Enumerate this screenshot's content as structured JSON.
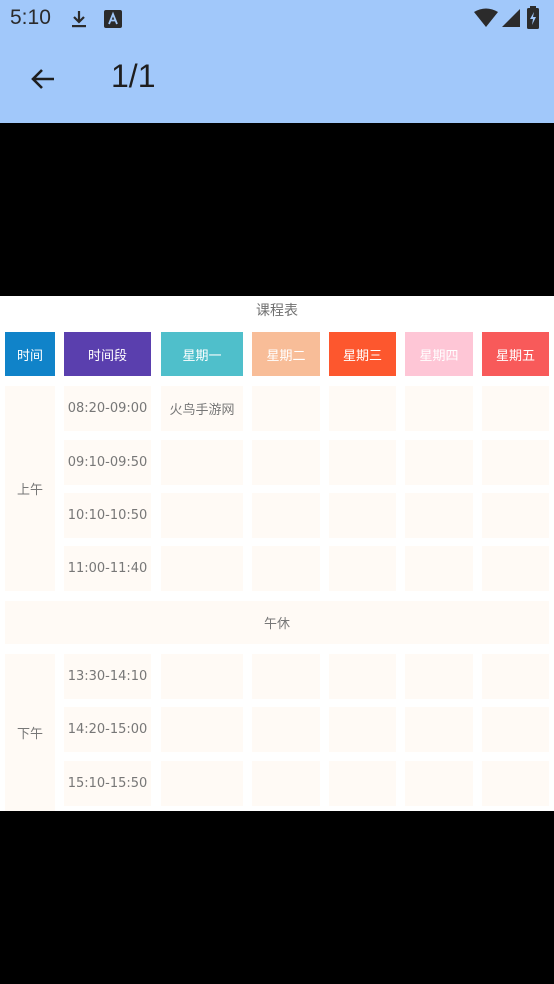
{
  "status_bar": {
    "time": "5:10",
    "icons": [
      "download-icon",
      "a-icon",
      "wifi-icon",
      "signal-icon",
      "battery-icon"
    ]
  },
  "toolbar": {
    "title": "1/1",
    "back_icon": "arrow-back-icon"
  },
  "timetable": {
    "caption": "课程表",
    "headers": [
      "时间",
      "时间段",
      "星期一",
      "星期二",
      "星期三",
      "星期四",
      "星期五"
    ],
    "header_colors": [
      "#1083c9",
      "#5a3fae",
      "#4fbfcb",
      "#f8bd98",
      "#fd572e",
      "#fec6d6",
      "#f85a5a"
    ],
    "morning_label": "上午",
    "morning_periods": [
      "08:20-09:00",
      "09:10-09:50",
      "10:10-10:50",
      "11:00-11:40"
    ],
    "morning_courses": [
      [
        "火鸟手游网",
        "",
        "",
        "",
        ""
      ],
      [
        "",
        "",
        "",
        "",
        ""
      ],
      [
        "",
        "",
        "",
        "",
        ""
      ],
      [
        "",
        "",
        "",
        "",
        ""
      ]
    ],
    "break_label": "午休",
    "afternoon_label": "下午",
    "afternoon_periods": [
      "13:30-14:10",
      "14:20-15:00",
      "15:10-15:50"
    ],
    "afternoon_courses": [
      [
        "",
        "",
        "",
        "",
        ""
      ],
      [
        "",
        "",
        "",
        "",
        ""
      ],
      [
        "",
        "",
        "",
        "",
        ""
      ]
    ]
  }
}
